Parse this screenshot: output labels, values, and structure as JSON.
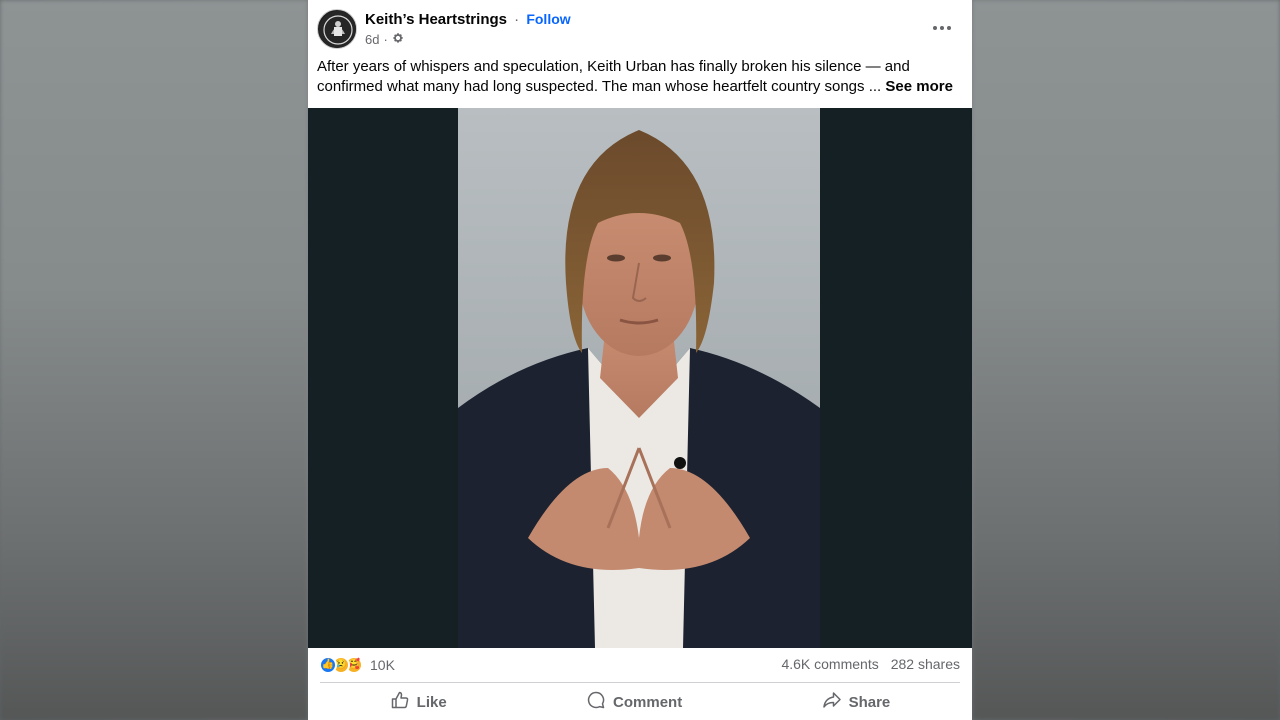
{
  "post": {
    "page_name": "Keith’s Heartstrings",
    "separator": "·",
    "follow_label": "Follow",
    "time": "6d",
    "time_separator": "·",
    "privacy_icon": "gear-icon",
    "more_icon": "more-options-icon",
    "caption": "After years of whispers and speculation, Keith Urban has finally broken his silence — and confirmed what many had long suspected. The man whose heartfelt country songs ...",
    "see_more_label": "See more"
  },
  "stats": {
    "reaction_icons": [
      "like",
      "sad",
      "care"
    ],
    "reaction_count": "10K",
    "comments": "4.6K comments",
    "shares": "282 shares"
  },
  "actions": {
    "like_label": "Like",
    "comment_label": "Comment",
    "share_label": "Share"
  },
  "colors": {
    "accent": "#0866ff",
    "like_blue": "#1877f2",
    "text_secondary": "#65676b",
    "media_bg": "#142024"
  }
}
